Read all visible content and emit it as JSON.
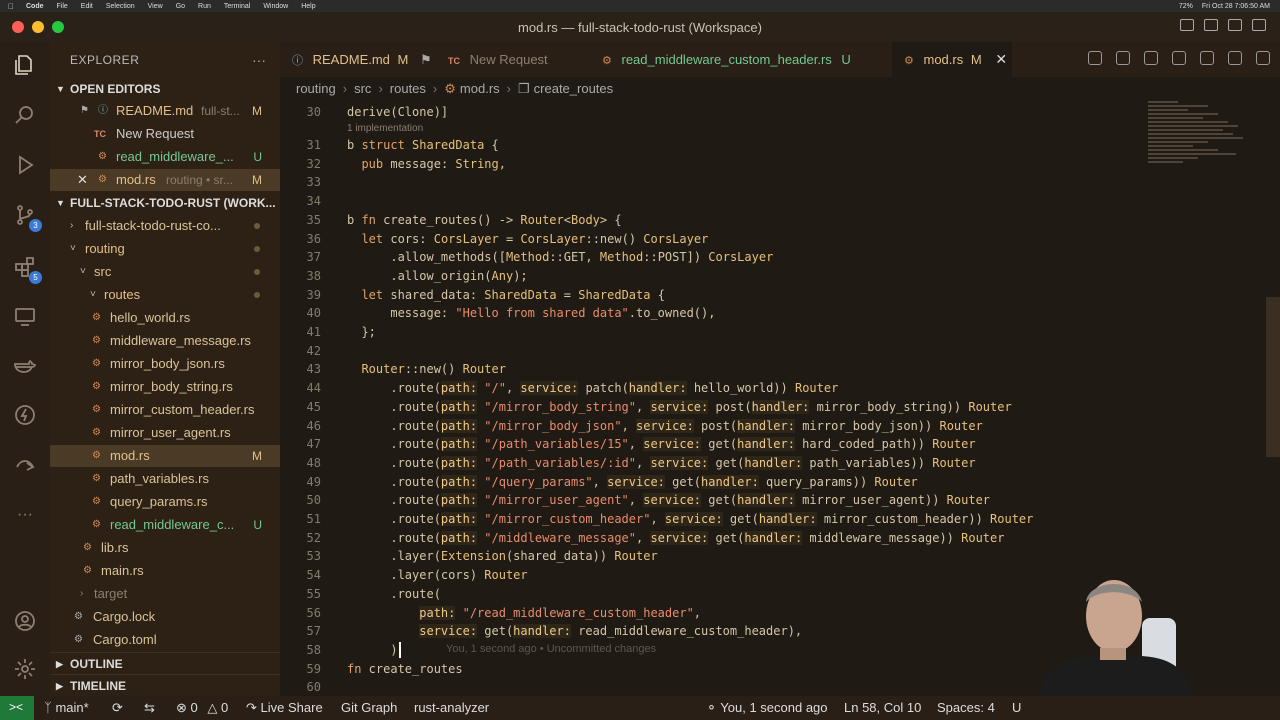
{
  "menubar": {
    "app": "Code",
    "items": [
      "File",
      "Edit",
      "Selection",
      "View",
      "Go",
      "Run",
      "Terminal",
      "Window",
      "Help"
    ],
    "battery": "72%",
    "clock": "Fri Oct 28  7:06:50 AM"
  },
  "window": {
    "title": "mod.rs — full-stack-todo-rust (Workspace)"
  },
  "activity": {
    "scm_badge": "3",
    "ext_badge": "5"
  },
  "sidebar": {
    "title": "EXPLORER",
    "open_editors": {
      "label": "OPEN EDITORS",
      "items": [
        {
          "name": "README.md",
          "hint": "full-st...",
          "status": "M"
        },
        {
          "name": "New Request",
          "hint": "",
          "status": ""
        },
        {
          "name": "read_middleware_...",
          "hint": "",
          "status": "U"
        },
        {
          "name": "mod.rs",
          "hint": "routing • sr...",
          "status": "M"
        }
      ]
    },
    "workspace": {
      "label": "FULL-STACK-TODO-RUST (WORK...",
      "tree": [
        {
          "name": "full-stack-todo-rust-co..."
        },
        {
          "name": "routing"
        },
        {
          "name": "src"
        },
        {
          "name": "routes"
        },
        {
          "name": "hello_world.rs"
        },
        {
          "name": "middleware_message.rs"
        },
        {
          "name": "mirror_body_json.rs"
        },
        {
          "name": "mirror_body_string.rs"
        },
        {
          "name": "mirror_custom_header.rs"
        },
        {
          "name": "mirror_user_agent.rs"
        },
        {
          "name": "mod.rs",
          "status": "M"
        },
        {
          "name": "path_variables.rs"
        },
        {
          "name": "query_params.rs"
        },
        {
          "name": "read_middleware_c...",
          "status": "U"
        },
        {
          "name": "lib.rs"
        },
        {
          "name": "main.rs"
        },
        {
          "name": "target"
        },
        {
          "name": "Cargo.lock"
        },
        {
          "name": "Cargo.toml"
        }
      ]
    },
    "outline": "OUTLINE",
    "timeline": "TIMELINE"
  },
  "tabs": [
    {
      "label": "README.md",
      "status": "M"
    },
    {
      "label": "New Request",
      "status": ""
    },
    {
      "label": "read_middleware_custom_header.rs",
      "status": "U"
    },
    {
      "label": "mod.rs",
      "status": "M"
    }
  ],
  "breadcrumb": [
    "routing",
    "src",
    "routes",
    "mod.rs",
    "create_routes"
  ],
  "editor": {
    "codelens": "1 implementation",
    "ghost_blame": "You, 1 second ago • Uncommitted changes",
    "line_numbers": [
      "30",
      "31",
      "32",
      "33",
      "34",
      "35",
      "36",
      "37",
      "38",
      "39",
      "40",
      "41",
      "42",
      "43",
      "44",
      "45",
      "46",
      "47",
      "48",
      "49",
      "50",
      "51",
      "52",
      "53",
      "54",
      "55",
      "56",
      "57",
      "58",
      "59",
      "60"
    ],
    "lines": [
      {
        "n": 30,
        "text": "derive(Clone)]"
      },
      {
        "n": 31,
        "text": "b struct SharedData {"
      },
      {
        "n": 32,
        "text": "  pub message: String,"
      },
      {
        "n": 33,
        "text": ""
      },
      {
        "n": 34,
        "text": ""
      },
      {
        "n": 35,
        "text": "b fn create_routes() -> Router<Body> {"
      },
      {
        "n": 36,
        "text": "  let cors: CorsLayer = CorsLayer::new() CorsLayer"
      },
      {
        "n": 37,
        "text": "      .allow_methods([Method::GET, Method::POST]) CorsLayer"
      },
      {
        "n": 38,
        "text": "      .allow_origin(Any);"
      },
      {
        "n": 39,
        "text": "  let shared_data: SharedData = SharedData {"
      },
      {
        "n": 40,
        "text": "      message: \"Hello from shared data\".to_owned(),"
      },
      {
        "n": 41,
        "text": "  };"
      },
      {
        "n": 42,
        "text": ""
      },
      {
        "n": 43,
        "text": "  Router::new() Router"
      },
      {
        "n": 44,
        "text": "      .route(path: \"/\", service: patch(handler: hello_world)) Router"
      },
      {
        "n": 45,
        "text": "      .route(path: \"/mirror_body_string\", service: post(handler: mirror_body_string)) Router"
      },
      {
        "n": 46,
        "text": "      .route(path: \"/mirror_body_json\", service: post(handler: mirror_body_json)) Router"
      },
      {
        "n": 47,
        "text": "      .route(path: \"/path_variables/15\", service: get(handler: hard_coded_path)) Router"
      },
      {
        "n": 48,
        "text": "      .route(path: \"/path_variables/:id\", service: get(handler: path_variables)) Router"
      },
      {
        "n": 49,
        "text": "      .route(path: \"/query_params\", service: get(handler: query_params)) Router"
      },
      {
        "n": 50,
        "text": "      .route(path: \"/mirror_user_agent\", service: get(handler: mirror_user_agent)) Router"
      },
      {
        "n": 51,
        "text": "      .route(path: \"/mirror_custom_header\", service: get(handler: mirror_custom_header)) Router"
      },
      {
        "n": 52,
        "text": "      .route(path: \"/middleware_message\", service: get(handler: middleware_message)) Router"
      },
      {
        "n": 53,
        "text": "      .layer(Extension(shared_data)) Router"
      },
      {
        "n": 54,
        "text": "      .layer(cors) Router"
      },
      {
        "n": 55,
        "text": "      .route("
      },
      {
        "n": 56,
        "text": "          path: \"/read_middleware_custom_header\","
      },
      {
        "n": 57,
        "text": "          service: get(handler: read_middleware_custom_header),"
      },
      {
        "n": 58,
        "text": "      )"
      },
      {
        "n": 59,
        "text": "fn create_routes"
      },
      {
        "n": 60,
        "text": ""
      }
    ]
  },
  "statusbar": {
    "branch": "main*",
    "problems": "0",
    "warnings": "0",
    "live_share": "Live Share",
    "git_graph": "Git Graph",
    "rust_analyzer": "rust-analyzer",
    "blame": "You, 1 second ago",
    "position": "Ln 58, Col 10",
    "spaces": "Spaces: 4",
    "encoding": "U"
  },
  "colors": {
    "accent_modified": "#e2c08d",
    "accent_untracked": "#73c991",
    "remote_indicator": "#1f7a3a"
  }
}
